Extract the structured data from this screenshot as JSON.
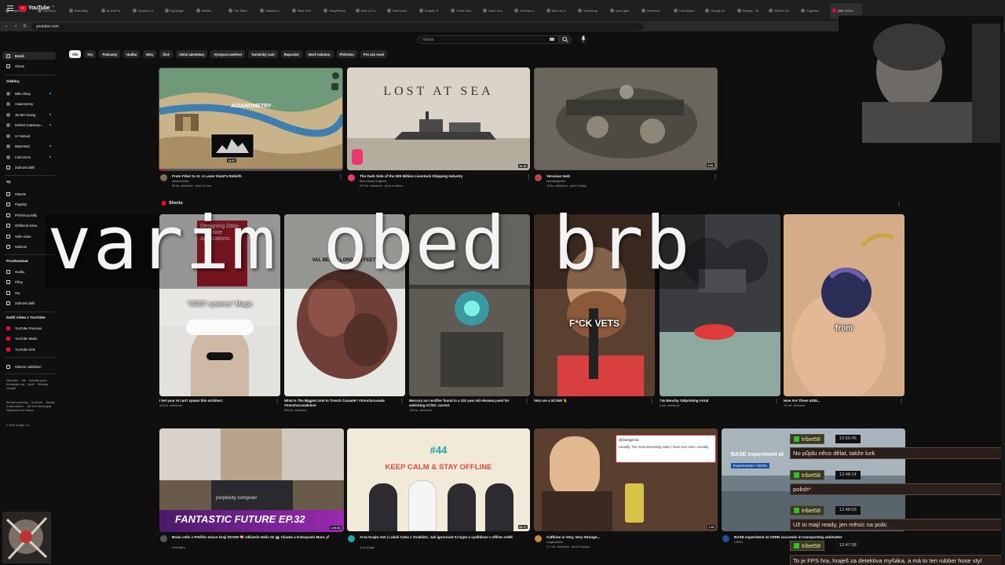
{
  "browser": {
    "tabs": [
      "Rejter pay",
      "terpelty/p",
      "Raw Migr",
      "AI and Fa",
      "Syntora | s",
      "Hyprpage",
      "Altoftio",
      "The State",
      "Haskell fo",
      "State of R",
      "HazyResea",
      "How to Co",
      "Democrac",
      "Chapter 5",
      "Curtis Yarv",
      "Open-Sou",
      "A Dream o",
      "Why do m",
      "Snowdrop",
      "open-ghid",
      "Inference",
      "TurboQuan",
      "Google AI",
      "Essays - Sc",
      "What is Ev",
      "Cognition",
      "(88) YouTu"
    ],
    "active_tab_index": 26,
    "url": "youtube.com"
  },
  "masthead": {
    "logo_text": "YouTube",
    "logo_region": "CZ",
    "search_placeholder": "Hledat"
  },
  "chips": [
    "Vše",
    "Hry",
    "Podcasty",
    "Hudba",
    "Mixy",
    "Živě",
    "Akční adventury",
    "Vývojová umělost",
    "Turistický ruch",
    "Rapování",
    "Nově nahráno",
    "Přehráno",
    "Pro vás nové"
  ],
  "sidebar": {
    "main": [
      {
        "label": "Domů",
        "icon": "home-icon"
      },
      {
        "label": "Shorts",
        "icon": "shorts-icon"
      }
    ],
    "subscriptions_heading": "Odběry",
    "subscriptions": [
      "Mike Okay",
      "Asianometry",
      "Jia-Bin Huang",
      "Defiant Gatekeep...",
      "Lit Nomad",
      "M&Jmetal",
      "Cold Ones",
      "Zobrazit další"
    ],
    "you_heading": "Vy",
    "you": [
      "Historie",
      "Playlisty",
      "Přehrát později",
      "Oblíbená videa",
      "Vaše videa",
      "Stažené"
    ],
    "explore_heading": "Prozkoumat",
    "explore": [
      "Hudba",
      "Filmy",
      "Hry",
      "Zobrazit další"
    ],
    "more_heading": "Další videa z YouTube",
    "more": [
      "YouTube Premium",
      "YouTube Music",
      "YouTube Kids"
    ],
    "history_settings": "Historie nahlášení",
    "footer1": [
      "Informace",
      "Tisk",
      "Autorská práva",
      "Kontaktujte nás",
      "Autoři",
      "Reklamy",
      "Vývojáři"
    ],
    "footer2": [
      "Smluvní podmínky",
      "Soukromí",
      "Zásady a zabezpečení",
      "Jak YouTube funguje",
      "Vyzkoušet nové funkce"
    ],
    "copyright": "© 2026 Google LLC"
  },
  "videos_row1": [
    {
      "title": "From Fiber to AI: A Laser Giant's Rebirth",
      "channel": "Asianometry",
      "stats": "92 tis. zhlédnutí · před 10 dny",
      "duration": "11:57",
      "thumb_text": "ASIANOMETRY"
    },
    {
      "title": "The Dark Side of the $20 Billion Livestock Shipping Industry",
      "channel": "Bloomberg Originals",
      "stats": "674 tis. zhlédnutí · před 4 měsíci",
      "duration": "26:26",
      "thumb_text": "LOST AT SEA"
    },
    {
      "title": "Verusian tank",
      "channel": "Idonategarden",
      "stats": "13 tis. zhlédnutí · před 2 týdny",
      "duration": "3:51"
    }
  ],
  "shorts": {
    "heading": "Shorts",
    "items": [
      {
        "title": "I bet your AI can't spawn this architect.",
        "stats": "313 tis. zhlédnutí",
        "caption": "\"CRDT systems\" Magic",
        "book": "Designing Data-Intensive Applications"
      },
      {
        "title": "What Is The Biggest Unit In Trench Crusade? #trenchcrusade #trenchcrusadelore",
        "stats": "326 tis. zhlédnutí",
        "caption": "VAL BEAST LORD 100 FEET!"
      },
      {
        "title": "Mercury arc rectifier found in a 102 year old elevator,used for switching AC/DC current",
        "stats": "128 tis. zhlédnutí",
        "caption": ""
      },
      {
        "title": "Vets are a SCAM! 🐈",
        "stats": "",
        "caption": "F*CK VETS"
      },
      {
        "title": "74s Benchy #3dprinting #viral",
        "stats": "4 mil. zhlédnutí",
        "caption": ""
      },
      {
        "title": "How Are These 4208...",
        "stats": "10 mil. zhlédnutí",
        "caption": "from"
      }
    ]
  },
  "videos_row3": [
    {
      "title": "Brain cells v Petřího misce hrají DOOM 🧠 Uklizeče Helix 02 🤖 Claude a Kobayashi Maru 🚀",
      "channel": "Petr Mára",
      "stats": "",
      "duration": "1:09:52",
      "thumb_text": "FANTASTIC FUTURE  EP.32",
      "thumb_sub": "perplexity  computer"
    },
    {
      "title": "AI ta Krajta #44 | Lukáš Caha z Youklidu: Jak ignorovat AI hype a vydělávat v offline světě",
      "channel": "AI ta Krajta",
      "stats": "",
      "duration": "52:17",
      "thumb_text": "KEEP CALM & STAY OFFLINE",
      "episode": "#44"
    },
    {
      "title": "Caffeine is Very, Very Strange...",
      "channel": "vlogbrothers",
      "stats": "2,7 mil. zhlédnutí · před 8 měsíci",
      "duration": "7:15",
      "tweet_user": "@Ganyjercia",
      "tweet_text": "Literally. The most interesting video I have ever seen. Literally."
    },
    {
      "title": "BASE experiment at CERN succeeds in transporting antimatter",
      "channel": "CERN",
      "stats": "",
      "duration": "",
      "thumb_text": "BASE experiment at",
      "thumb_sub": "Experiments • CERN"
    }
  ],
  "overlay_text": "varim obed brb",
  "chat": [
    {
      "user": "tribet58",
      "time": "12:50:45",
      "message": "No půjdu něco dělat, takže lurk"
    },
    {
      "user": "tribet58",
      "time": "12:48:14",
      "message": "polish*"
    },
    {
      "user": "tribet58",
      "time": "12:48:03",
      "message": "Už to mají ready, jen měsíc na polic"
    },
    {
      "user": "tribet58",
      "time": "12:47:38",
      "message": "To je FPS hra, hraješ za detektiva myšáka, a má to ten rubber hose styl"
    }
  ],
  "colors": {
    "background": "#0f0f0f",
    "brand_red": "#ff0033",
    "chip_bg": "#272727",
    "chat_user_bg": "#3a3a1a",
    "chat_msg_bg": "#2b1f1c"
  }
}
